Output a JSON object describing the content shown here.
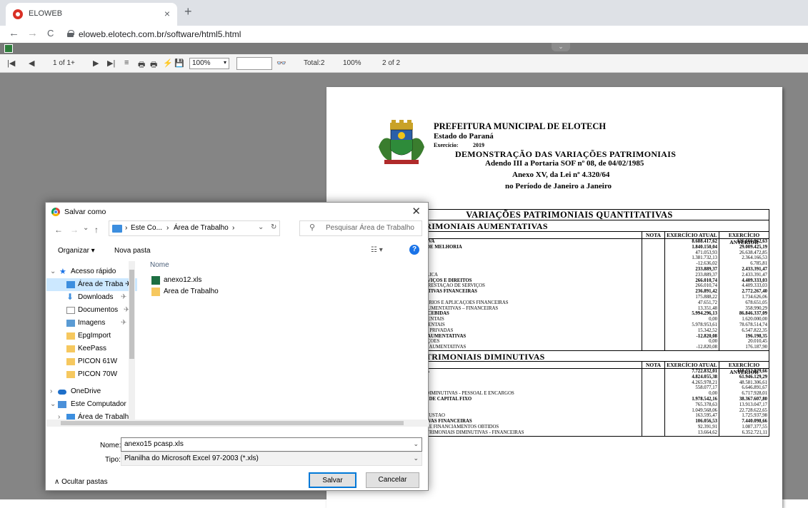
{
  "browser": {
    "tab_title": "ELOWEB",
    "tab_close": "×",
    "new_tab": "+",
    "back": "←",
    "forward": "→",
    "reload": "C",
    "url": "eloweb.elotech.com.br/software/html5.html"
  },
  "viewer_toolbar": {
    "first": "|◀",
    "prev": "◀",
    "page_of": "1 of 1+",
    "next": "▶",
    "last": "▶|",
    "stop": "≡",
    "print1": "🖶",
    "print2": "🖶",
    "export": "⚡",
    "save": "💾",
    "zoom": "100%",
    "zoom_arrow": "▾",
    "find": "👓",
    "total": "Total:2",
    "percent": "100%",
    "pages": "2 of 2",
    "collapse": "⌄"
  },
  "report": {
    "org": "PREFEITURA MUNICIPAL DE ELOTECH",
    "state": "Estado do Paraná",
    "exercise_label": "Exercício:",
    "exercise_year": "2019",
    "title": "DEMONSTRAÇÃO DAS VARIAÇÕES PATRIMONIAIS",
    "line1": "Adendo III a Portaria SOF nº 08, de 04/02/1985",
    "line2": "Anexo XV, da Lei nº 4.320/64",
    "line3": "no Período de Janeiro a Janeiro",
    "section": "VARIAÇÕES PATRIMONIAIS QUANTITATIVAS",
    "aumentativas": {
      "title": "IAÇÕES PATRIMONIAIS AUMENTATIVAS",
      "headers": [
        "NOTA",
        "EXERCÍCIO ATUAL",
        "EXERCÍCIO ANTERIOR"
      ],
      "rows": [
        {
          "d": "RIMONIAL AUMENTATIVA",
          "a": "8.688.417,62",
          "p": "126.666.962,63",
          "b": true
        },
        {
          "d": "AS E CONTRIBUIÇÕES DE MELHORIA",
          "a": "1.840.150,04",
          "p": "29.009.425,19",
          "b": true
        },
        {
          "d": "",
          "a": "471.053,93",
          "p": "26.638.472,85",
          "b": false
        },
        {
          "d": "",
          "a": "1.381.732,13",
          "p": "2.364.166,53",
          "b": false
        },
        {
          "d": "ÕES DE MELHORIA",
          "a": "-12.636,02",
          "p": "6.785,81",
          "b": false
        },
        {
          "d": "ES",
          "a": "233.889,37",
          "p": "2.433.391,47",
          "b": true
        },
        {
          "d": "O DE ILUMINAÇÃO PÚBLICA",
          "a": "233.889,37",
          "p": "2.433.391,47",
          "b": false
        },
        {
          "d": "E VENDA DE BENS, SERVIÇOS E DIREITOS",
          "a": "266.010,74",
          "p": "4.409.333,03",
          "b": true
        },
        {
          "d": "DE BENS E DIREITOS E PRESTAÇÃO DE SERVIÇOS",
          "a": "266.010,74",
          "p": "4.409.333,03",
          "b": false
        },
        {
          "d": "TRIMONIAIS AUMENTATIVAS FINANCEIRAS",
          "a": "236.891,42",
          "p": "2.772.267,40",
          "b": true
        },
        {
          "d": "RGOS DE MORA",
          "a": "175.888,22",
          "p": "1.734.626,06",
          "b": false
        },
        {
          "d": "O DE DEPÓSITOS BANCÁRIOS E APLICAÇÕES FINANCEIRAS",
          "a": "47.651,72",
          "p": "678.651,05",
          "b": false
        },
        {
          "d": "AÇÕES PATRIMONIAIS AUMENTATIVAS – FINANCEIRAS",
          "a": "13.351,48",
          "p": "358.990,29",
          "b": false
        },
        {
          "d": "IAS E DELEGAÇÕES RECEBIDAS",
          "a": "5.994.296,13",
          "p": "86.846.337,09",
          "b": true
        },
        {
          "d": "CIAS INTRAGOVERNAMENTAIS",
          "a": "0,00",
          "p": "1.620.000,00",
          "b": false
        },
        {
          "d": "CIAS INTER GOVERNAMENTAIS",
          "a": "5.978.953,61",
          "p": "78.678.514,74",
          "b": false
        },
        {
          "d": "CIAS DAS INSTITUIÇÕES PRIVADAS",
          "a": "15.342,52",
          "p": "6.547.822,35",
          "b": false
        },
        {
          "d": "AÇÕES PATRIMONIAIS AUMENTATIVAS",
          "a": "-12.820,08",
          "p": "196.198,35",
          "b": true
        },
        {
          "d": "POSITIVO DE PARTICIPAÇÕES",
          "a": "0,00",
          "p": "20.010,45",
          "b": false
        },
        {
          "d": "RIAÇÕES PATRIMONIAIS AUMENTATIVAS",
          "a": "-12.820,08",
          "p": "176.187,90",
          "b": false
        }
      ]
    },
    "diminutivas": {
      "title": "RIAÇÕES PATRIMONIAIS DIMINUTIVAS",
      "headers": [
        "NOTA",
        "EXERCÍCIO ATUAL",
        "EXERCÍCIO ANTERIOR"
      ],
      "rows": [
        {
          "d": "RIMONIAL DIMINUTIVA",
          "a": "7.722.832,01",
          "p": "118.312.829,66",
          "b": true
        },
        {
          "d": "CARGOS",
          "a": "4.824.055,38",
          "p": "61.946.129,29",
          "b": true
        },
        {
          "d": "ÃO A PESSOAL",
          "a": "4.265.978,21",
          "p": "48.581.306,61",
          "b": false
        },
        {
          "d": "ATRONAIS",
          "a": "558.077,17",
          "p": "6.646.891,67",
          "b": false
        },
        {
          "d": "IAÇÕES PATRIMONIAIS DIMINUTIVAS - PESSOAL E ENCARGOS",
          "a": "0,00",
          "p": "6.717.928,01",
          "b": false
        },
        {
          "d": "SERVIÇOS E CONSUMO DE CAPITAL FIXO",
          "a": "1.978.542,16",
          "p": "38.367.607,80",
          "b": true
        },
        {
          "d": "RIAL DE CONSUMO",
          "a": "765.378,63",
          "p": "13.913.047,17",
          "b": false
        },
        {
          "d": "",
          "a": "1.049.568,06",
          "p": "22.728.622,65",
          "b": false
        },
        {
          "d": "O, AMORTIZAÇÃO E EXAUSTÃO",
          "a": "163.595,47",
          "p": "1.725.937,98",
          "b": false
        },
        {
          "d": "TRIMONIAIS DIMINUTIVAS FINANCEIRAS",
          "a": "106.056,53",
          "p": "7.440.098,66",
          "b": true
        },
        {
          "d": "RGOS DE EMPRÉSTIMOS E FINANCIAMENTOS OBTIDOS",
          "a": "92.391,91",
          "p": "1.087.377,55",
          "b": false
        },
        {
          "d": "OUTRAS VARIAÇÕES PATRIMONIAIS DIMINUTIVAS - FINANCEIRAS",
          "a": "13.664,62",
          "p": "6.352.721,11",
          "b": false
        }
      ]
    }
  },
  "dialog": {
    "title": "Salvar como",
    "close": "✕",
    "back": "←",
    "forward": "→",
    "down": "⌄",
    "up": "↑",
    "crumb1": "Este Co...",
    "crumb2": "Área de Trabalho",
    "crumb_sep": "›",
    "refresh": "↻",
    "search_placeholder": "Pesquisar Área de Trabalho",
    "organize": "Organizar ▾",
    "new_folder": "Nova pasta",
    "view": "☷ ▾",
    "help": "?",
    "column_name": "Nome",
    "nav": [
      {
        "label": "Acesso rápido",
        "color": "#1a73e8"
      },
      {
        "label": "Área de Traba ✈",
        "color": "#3c8edf"
      },
      {
        "label": "Downloads",
        "color": "#3c8edf"
      },
      {
        "label": "Documentos",
        "color": "#8a8a8a"
      },
      {
        "label": "Imagens",
        "color": "#5a9bd4"
      },
      {
        "label": "EpgImport",
        "color": "#f6c85f"
      },
      {
        "label": "KeePass",
        "color": "#f6c85f"
      },
      {
        "label": "PICON 61W",
        "color": "#f6c85f"
      },
      {
        "label": "PICON 70W",
        "color": "#f6c85f"
      },
      {
        "label": "OneDrive",
        "color": "#1e6fc9"
      },
      {
        "label": "Este Computador",
        "color": "#4a90d9"
      },
      {
        "label": "Área de Trabalho",
        "color": "#3c8edf"
      }
    ],
    "pin": "✈",
    "expand": "›",
    "collapse": "⌄",
    "files": [
      {
        "name": "anexo12.xls",
        "type": "excel"
      },
      {
        "name": "Area de Trabalho",
        "type": "folder"
      }
    ],
    "filename_label": "Nome:",
    "filename_value": "anexo15 pcasp.xls",
    "filetype_label": "Tipo:",
    "filetype_value": "Planilha do Microsoft Excel 97-2003 (*.xls)",
    "dropdown_arrow": "⌄",
    "hide_folders": "∧  Ocultar pastas",
    "save_button": "Salvar",
    "cancel_button": "Cancelar"
  }
}
